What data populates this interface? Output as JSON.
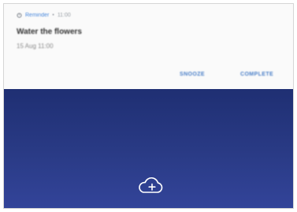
{
  "notification": {
    "app_name": "Reminder",
    "time": "11:00",
    "title": "Water the flowers",
    "subtitle": "15 Aug 11:00",
    "actions": {
      "snooze": "SNOOZE",
      "complete": "COMPLETE"
    }
  },
  "icons": {
    "app": "reminder-icon",
    "add": "cloud-add-icon"
  },
  "colors": {
    "accent": "#4a7fc8",
    "background": "#24347a",
    "card": "#fafafa"
  }
}
